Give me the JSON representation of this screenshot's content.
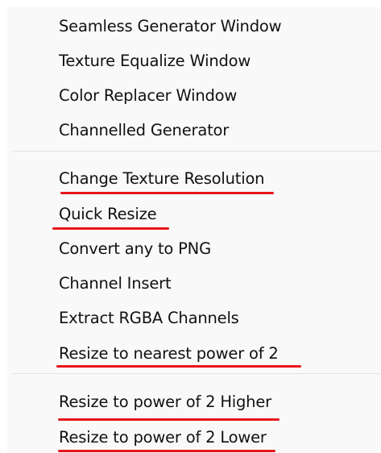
{
  "menu": {
    "groups": [
      {
        "items": [
          {
            "label": "Seamless Generator Window"
          },
          {
            "label": "Texture Equalize Window"
          },
          {
            "label": "Color Replacer Window"
          },
          {
            "label": "Channelled Generator"
          }
        ]
      },
      {
        "items": [
          {
            "label": "Change Texture Resolution",
            "underlined": true
          },
          {
            "label": "Quick Resize",
            "underlined": true
          },
          {
            "label": "Convert any to PNG"
          },
          {
            "label": "Channel Insert"
          },
          {
            "label": "Extract RGBA Channels"
          },
          {
            "label": "Resize to nearest power of 2",
            "underlined": true
          }
        ]
      },
      {
        "items": [
          {
            "label": "Resize to power of 2 Higher",
            "underlined": true
          },
          {
            "label": "Resize to power of 2 Lower",
            "underlined": true
          }
        ]
      }
    ]
  },
  "colors": {
    "menu_background": "#f9f9f9",
    "text": "#111111",
    "separator": "#e3e3e3",
    "annotation_underline": "#e8141b"
  }
}
